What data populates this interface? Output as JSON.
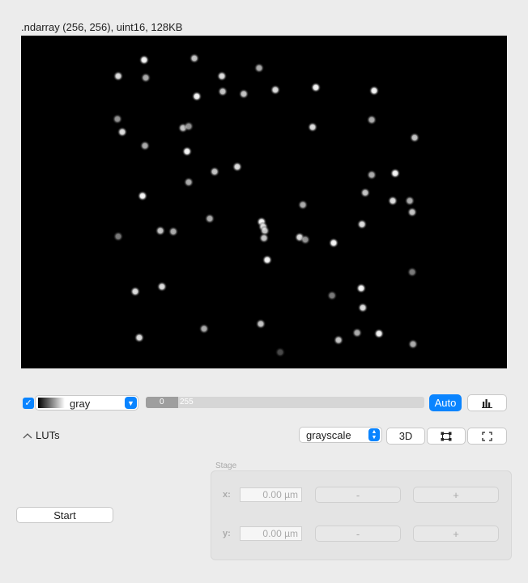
{
  "title": ".ndarray (256, 256), uint16, 128KB",
  "controls": {
    "checkbox_checked": true,
    "colormap": "gray",
    "range_low": "0",
    "range_high": "255",
    "range_fraction": 0.115,
    "auto_label": "Auto",
    "accent_color": "#0a84ff"
  },
  "luts": {
    "toggle_label": "LUTs",
    "lut_mode": "grayscale",
    "btn_3d": "3D"
  },
  "actions": {
    "start_label": "Start"
  },
  "stage": {
    "title": "Stage",
    "x_label": "x:",
    "y_label": "y:",
    "x_value": "0.00 µm",
    "y_value": "0.00 µm",
    "minus": "-",
    "plus": "+"
  },
  "icons": [
    "check-icon",
    "chevron-down-icon",
    "histogram-icon",
    "chevron-up-icon",
    "updown-icon",
    "roi-icon",
    "fullscreen-icon"
  ]
}
